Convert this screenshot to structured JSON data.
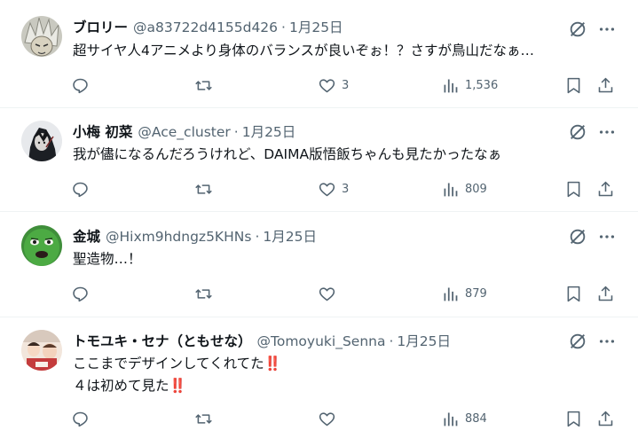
{
  "colors": {
    "text": "#0f1419",
    "muted": "#536471",
    "divider": "#eff3f4",
    "emphasis": "#d6223a"
  },
  "icons": {
    "reply": "reply-icon",
    "repost": "repost-icon",
    "like": "like-icon",
    "views": "views-icon",
    "bookmark": "bookmark-icon",
    "share": "share-icon",
    "grok": "grok-icon",
    "more": "more-icon"
  },
  "posts": [
    {
      "name": "ブロリー",
      "handle": "@a83722d4155d426",
      "separator": "·",
      "date": "1月25日",
      "lines": [
        "超サイヤ人4アニメより身体のバランスが良いぞぉ！？さすが鳥山だなぁ…"
      ],
      "likes": "3",
      "views": "1,536"
    },
    {
      "name": "小梅 初菜",
      "handle": "@Ace_cluster",
      "separator": "·",
      "date": "1月25日",
      "lines": [
        "我が儘になるんだろうけれど、DAIMA版悟飯ちゃんも見たかったなぁ"
      ],
      "likes": "3",
      "views": "809"
    },
    {
      "name": "金城",
      "handle": "@Hixm9hdngz5KHNs",
      "separator": "·",
      "date": "1月25日",
      "lines": [
        "聖造物…！"
      ],
      "likes": "",
      "views": "879"
    },
    {
      "name": "トモユキ・セナ（ともせな）",
      "handle": "@Tomoyuki_Senna",
      "separator": "·",
      "date": "1月25日",
      "lines": [
        "ここまでデザインしてくれてた",
        "４は初めて見た"
      ],
      "emphasis": "‼️",
      "likes": "",
      "views": "884"
    }
  ]
}
